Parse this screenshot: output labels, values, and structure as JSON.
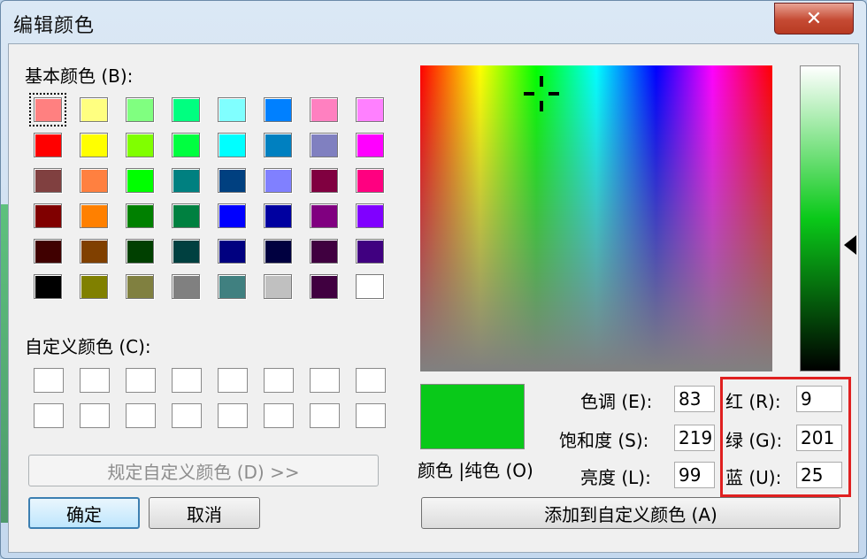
{
  "window": {
    "title": "编辑颜色",
    "close_glyph": "✕"
  },
  "basic": {
    "label": "基本颜色 (B):",
    "rows": [
      [
        "#ff8080",
        "#ffff80",
        "#80ff80",
        "#00ff80",
        "#80ffff",
        "#0080ff",
        "#ff80c0",
        "#ff80ff"
      ],
      [
        "#ff0000",
        "#ffff00",
        "#80ff00",
        "#00ff40",
        "#00ffff",
        "#0080c0",
        "#8080c0",
        "#ff00ff"
      ],
      [
        "#804040",
        "#ff8040",
        "#00ff00",
        "#008080",
        "#004080",
        "#8080ff",
        "#800040",
        "#ff0080"
      ],
      [
        "#800000",
        "#ff8000",
        "#008000",
        "#008040",
        "#0000ff",
        "#0000a0",
        "#800080",
        "#8000ff"
      ],
      [
        "#400000",
        "#804000",
        "#004000",
        "#004040",
        "#000080",
        "#000040",
        "#400040",
        "#400080"
      ],
      [
        "#000000",
        "#808000",
        "#808040",
        "#808080",
        "#408080",
        "#c0c0c0",
        "#400040",
        "#ffffff"
      ]
    ]
  },
  "custom": {
    "label": "自定义颜色 (C):",
    "count": 16
  },
  "buttons": {
    "define_custom": "规定自定义颜色 (D) >>",
    "ok": "确定",
    "cancel": "取消",
    "add_custom": "添加到自定义颜色 (A)"
  },
  "preview": {
    "label": "颜色 |纯色 (O)",
    "color": "#09c919"
  },
  "hsl": {
    "hue_label": "色调 (E):",
    "hue": "83",
    "sat_label": "饱和度 (S):",
    "sat": "219",
    "lum_label": "亮度 (L):",
    "lum": "99"
  },
  "rgb": {
    "red_label": "红 (R):",
    "red": "9",
    "green_label": "绿 (G):",
    "green": "201",
    "blue_label": "蓝 (U):",
    "blue": "25"
  },
  "colors": {
    "highlight_box": "#e02020",
    "default_button_border": "#3c7fb1"
  }
}
